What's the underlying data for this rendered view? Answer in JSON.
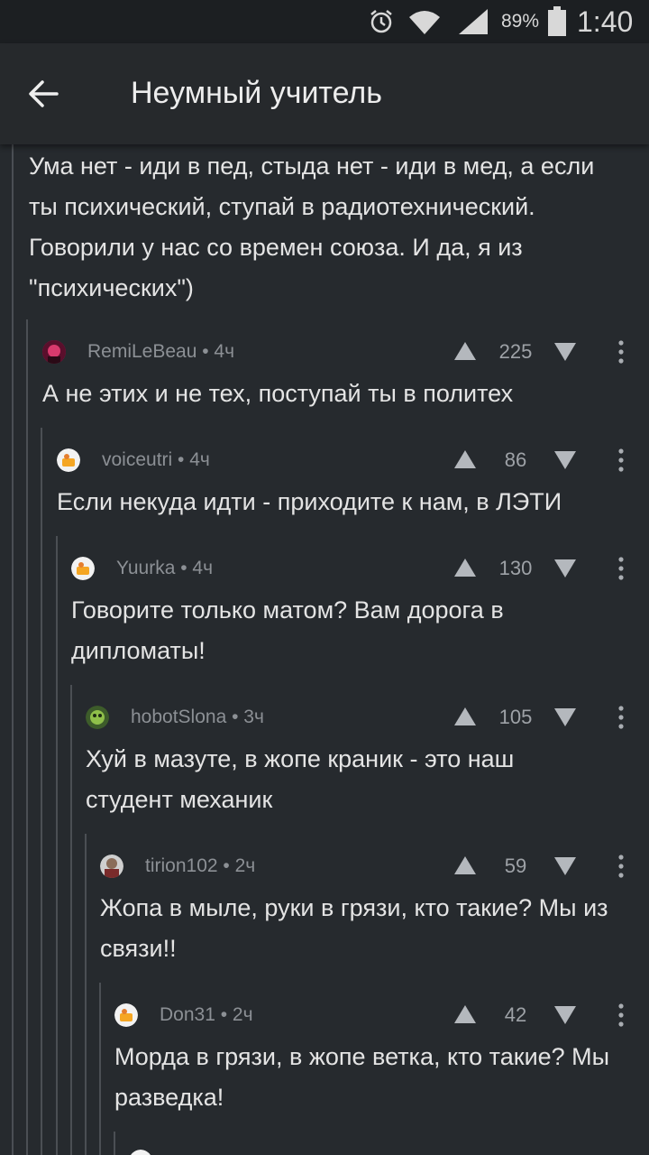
{
  "status_bar": {
    "battery_percent": "89%",
    "time": "1:40"
  },
  "app_bar": {
    "title": "Неумный учитель"
  },
  "parent_comment": {
    "text": "Ума нет - иди в пед, стыда нет - иди в мед, а если ты психический, ступай в радиотехнический. Говорили у нас со времен союза. И да, я из \"психических\")"
  },
  "comments": [
    {
      "meta": "RemiLeBeau • 4ч",
      "score": "225",
      "text": "А не этих и не тех, поступай ты в политех"
    },
    {
      "meta": "voiceutri • 4ч",
      "score": "86",
      "text": "Если некуда идти - приходите к нам, в ЛЭТИ"
    },
    {
      "meta": "Yuurka • 4ч",
      "score": "130",
      "text": "Говорите только матом? Вам дорога в дипломаты!"
    },
    {
      "meta": "hobotSlona • 3ч",
      "score": "105",
      "text": "Хуй в мазуте, в жопе краник - это наш студент механик"
    },
    {
      "meta": "tirion102 • 2ч",
      "score": "59",
      "text": "Жопа в мыле, руки в грязи, кто такие? Мы из связи!!"
    },
    {
      "meta": "Don31 • 2ч",
      "score": "42",
      "text": "Морда в грязи, в жопе ветка, кто такие? Мы разведка!"
    }
  ]
}
